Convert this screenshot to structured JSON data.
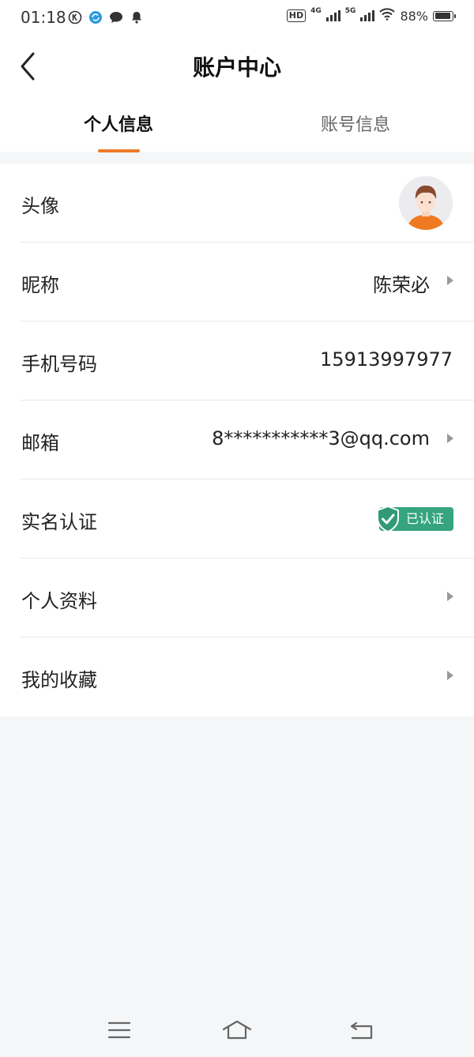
{
  "status_bar": {
    "time": "01:18",
    "battery": "88%",
    "hd_label": "HD",
    "net1": "4G",
    "net2": "5G",
    "icons": [
      "k-icon",
      "sync-icon",
      "chat-icon",
      "bell-icon",
      "hd-icon",
      "signal-icon",
      "wifi-icon",
      "battery-icon"
    ]
  },
  "header": {
    "title": "账户中心"
  },
  "tabs": [
    {
      "label": "个人信息",
      "active": true
    },
    {
      "label": "账号信息",
      "active": false
    }
  ],
  "rows": [
    {
      "label": "头像"
    },
    {
      "label": "昵称",
      "value": "陈荣必"
    },
    {
      "label": "手机号码",
      "value": "15913997977"
    },
    {
      "label": "邮箱",
      "value": "8***********3@qq.com"
    },
    {
      "label": "实名认证",
      "badge": "已认证"
    },
    {
      "label": "个人资料"
    },
    {
      "label": "我的收藏"
    }
  ],
  "colors": {
    "accent": "#ee7a2a",
    "verified": "#35a47f",
    "background": "#f5f6f8"
  },
  "navbar": {
    "icons": [
      "menu-icon",
      "home-icon",
      "back-icon"
    ]
  }
}
